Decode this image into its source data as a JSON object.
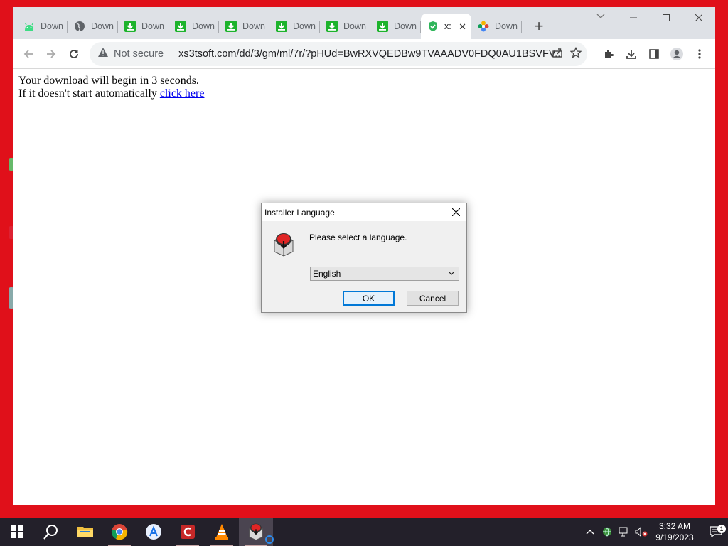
{
  "browser": {
    "tabs": [
      {
        "title": "Down",
        "icon": "android-icon"
      },
      {
        "title": "Down",
        "icon": "globe-icon"
      },
      {
        "title": "Down",
        "icon": "download-green-icon"
      },
      {
        "title": "Down",
        "icon": "download-green-icon"
      },
      {
        "title": "Down",
        "icon": "download-green-icon"
      },
      {
        "title": "Down",
        "icon": "download-green-icon"
      },
      {
        "title": "Down",
        "icon": "download-green-icon"
      },
      {
        "title": "Down",
        "icon": "download-green-icon"
      },
      {
        "title": "x:",
        "icon": "shield-check-icon",
        "active": true
      },
      {
        "title": "Down",
        "icon": "flower-icon"
      }
    ],
    "address": {
      "security_label": "Not secure",
      "url": "xs3tsoft.com/dd/3/gm/ml/7r/?pHUd=BwRXVQEDBw9TVAAADV0FDQ0AU1BSVFV..."
    },
    "page": {
      "line1": "Your download will begin in 3 seconds.",
      "line2_prefix": "If it doesn't start automatically",
      "link_text": "click here"
    }
  },
  "dialog": {
    "title": "Installer Language",
    "prompt": "Please select a language.",
    "selected_language": "English",
    "ok_label": "OK",
    "cancel_label": "Cancel"
  },
  "taskbar": {
    "time": "3:32 AM",
    "date": "9/19/2023",
    "notification_count": "1",
    "apps": [
      "start-icon",
      "search-icon",
      "file-explorer-icon",
      "chrome-icon",
      "app-store-icon",
      "ccleaner-icon",
      "vlc-icon",
      "installer-icon"
    ]
  }
}
